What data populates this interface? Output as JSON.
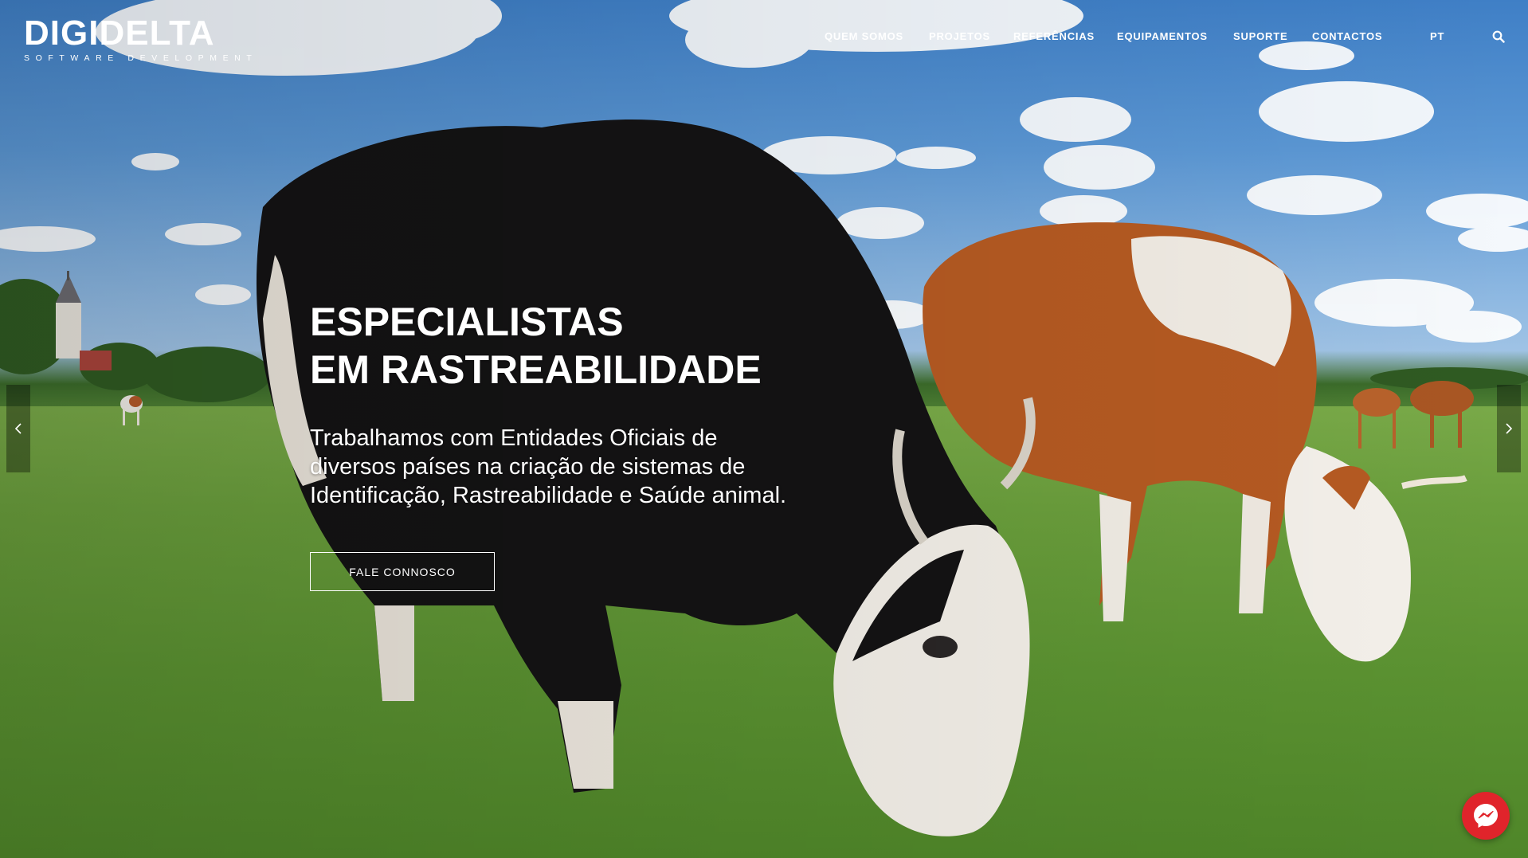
{
  "brand": {
    "name": "DIGIDELTA",
    "tagline": "SOFTWARE DEVELOPMENT"
  },
  "nav": {
    "items": [
      {
        "label": "QUEM SOMOS"
      },
      {
        "label": "PROJETOS"
      },
      {
        "label": "REFERÊNCIAS"
      },
      {
        "label": "EQUIPAMENTOS"
      },
      {
        "label": "SUPORTE"
      },
      {
        "label": "CONTACTOS"
      }
    ],
    "language": "PT",
    "search_icon": "search-icon"
  },
  "hero": {
    "headline_line1": "ESPECIALISTAS",
    "headline_line2": "EM RASTREABILIDADE",
    "lead": "Trabalhamos com Entidades Oficiais de diversos países na criação de sistemas de Identificação, Rastreabilidade e Saúde animal.",
    "cta_label": "FALE CONNOSCO"
  },
  "slider": {
    "prev_icon": "chevron-left-icon",
    "next_icon": "chevron-right-icon"
  },
  "chat": {
    "icon": "messenger-icon",
    "color": "#e0242b"
  }
}
